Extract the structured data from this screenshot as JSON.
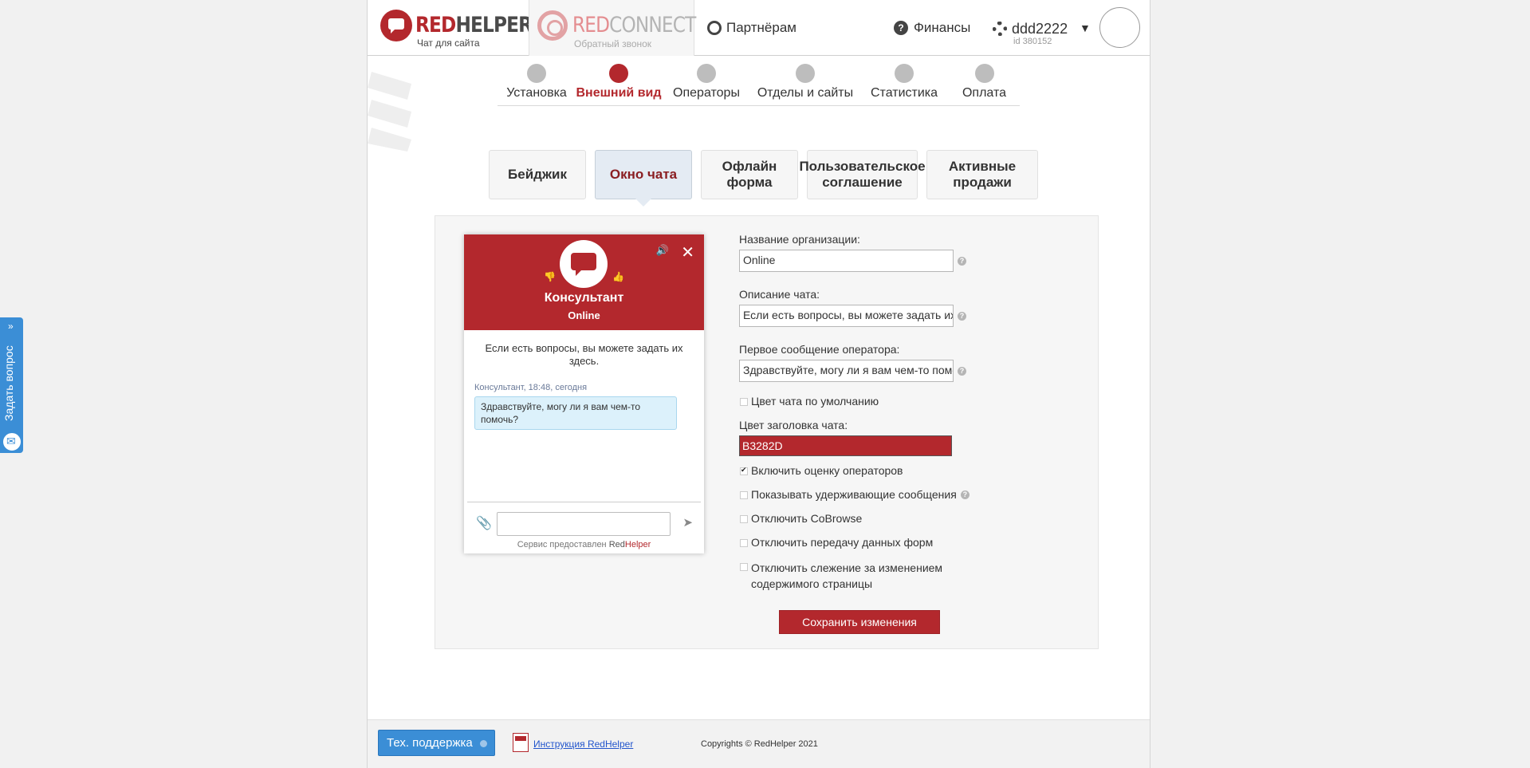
{
  "header": {
    "logo_redhelper": {
      "red": "RED",
      "grey": "HELPER",
      "sub": "Чат для сайта"
    },
    "logo_redconnect": {
      "red": "RED",
      "grey": "CONNECT",
      "sub": "Обратный звонок"
    },
    "partners": "Партнёрам",
    "finance": "Финансы",
    "username": "ddd2222",
    "user_id": "id 380152",
    "caret": "▼"
  },
  "nav": [
    {
      "label": "Установка",
      "icon": "gear-icon"
    },
    {
      "label": "Внешний вид",
      "icon": "wrench-icon",
      "active": true
    },
    {
      "label": "Операторы",
      "icon": "operator-icon"
    },
    {
      "label": "Отделы и сайты",
      "icon": "monitor-icon"
    },
    {
      "label": "Статистика",
      "icon": "stats-icon"
    },
    {
      "label": "Оплата",
      "icon": "dollar-icon"
    }
  ],
  "tabs": [
    {
      "label": "Бейджик"
    },
    {
      "label": "Окно чата",
      "active": true
    },
    {
      "label": "Офлайн форма"
    },
    {
      "label": "Пользовательское соглашение"
    },
    {
      "label": "Активные продажи"
    }
  ],
  "chat_preview": {
    "operator": "Консультант",
    "status": "Online",
    "description": "Если есть вопросы, вы можете задать их здесь.",
    "meta": "Консультант, 18:48, сегодня",
    "message": "Здравствуйте, могу ли я вам чем-то помочь?",
    "service": "Сервис предоставлен",
    "service_brand_grey": "Red",
    "service_brand_red": "Helper",
    "header_color": "#b3282d"
  },
  "form": {
    "org_label": "Название организации:",
    "org_value": "Online",
    "desc_label": "Описание чата:",
    "desc_value": "Если есть вопросы, вы можете задать их здесь.",
    "first_msg_label": "Первое сообщение оператора:",
    "first_msg_value": "Здравствуйте, могу ли я вам чем-то помочь?",
    "default_color_label": "Цвет чата по умолчанию",
    "header_color_label": "Цвет заголовка чата:",
    "header_color_value": "B3282D",
    "rating_label": "Включить оценку операторов",
    "holding_label": "Показывать удерживающие сообщения",
    "cobrowse_label": "Отключить CoBrowse",
    "forms_label": "Отключить передачу данных форм",
    "tracking_label": "Отключить слежение за изменением содержимого страницы",
    "save_label": "Сохранить изменения"
  },
  "footer": {
    "support": "Тех. поддержка",
    "manual": "Инструкция RedHelper",
    "copyright": "Copyrights © RedHelper 2021"
  },
  "side_widget": {
    "label": "Задать вопрос",
    "arrow": "»"
  }
}
